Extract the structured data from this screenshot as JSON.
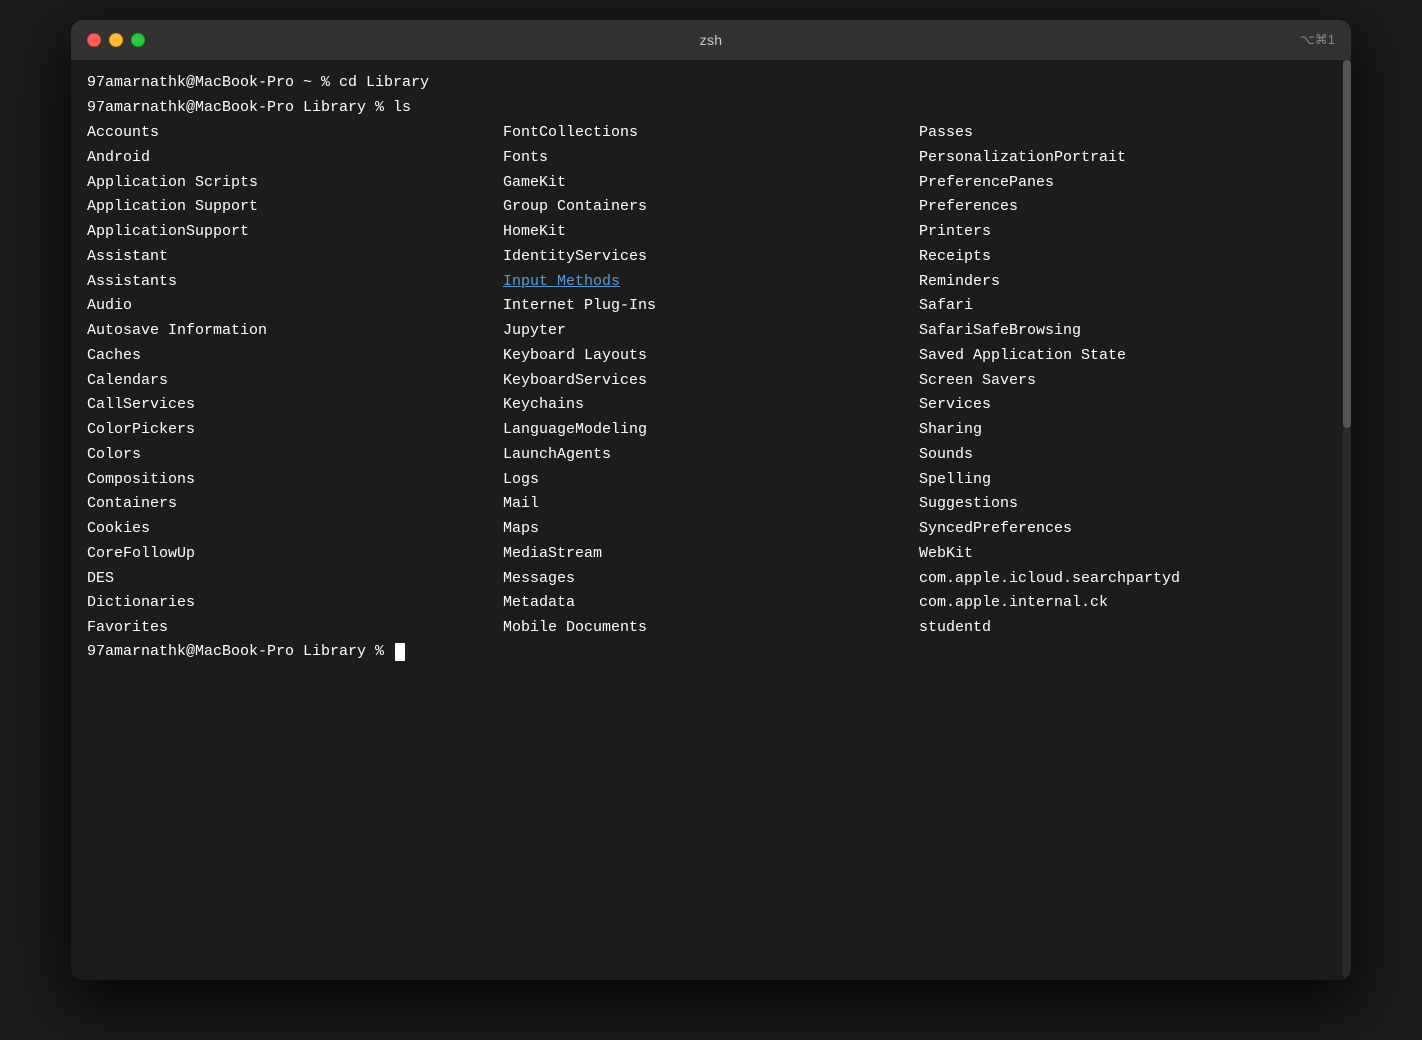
{
  "window": {
    "title": "zsh",
    "keyboard_shortcut": "⌥⌘1"
  },
  "traffic_lights": {
    "close_label": "close",
    "minimize_label": "minimize",
    "maximize_label": "maximize"
  },
  "terminal": {
    "prompt1": "97amarnathk@MacBook-Pro ~ % cd Library",
    "prompt2": "97amarnathk@MacBook-Pro Library % ls",
    "prompt3": "97amarnathk@MacBook-Pro Library % ",
    "columns": [
      [
        {
          "text": "Accounts",
          "link": false
        },
        {
          "text": "Android",
          "link": false
        },
        {
          "text": "Application Scripts",
          "link": false
        },
        {
          "text": "Application Support",
          "link": false
        },
        {
          "text": "ApplicationSupport",
          "link": false
        },
        {
          "text": "Assistant",
          "link": false
        },
        {
          "text": "Assistants",
          "link": false
        },
        {
          "text": "Audio",
          "link": false
        },
        {
          "text": "Autosave Information",
          "link": false
        },
        {
          "text": "Caches",
          "link": false
        },
        {
          "text": "Calendars",
          "link": false
        },
        {
          "text": "CallServices",
          "link": false
        },
        {
          "text": "ColorPickers",
          "link": false
        },
        {
          "text": "Colors",
          "link": false
        },
        {
          "text": "Compositions",
          "link": false
        },
        {
          "text": "Containers",
          "link": false
        },
        {
          "text": "Cookies",
          "link": false
        },
        {
          "text": "CoreFollowUp",
          "link": false
        },
        {
          "text": "DES",
          "link": false
        },
        {
          "text": "Dictionaries",
          "link": false
        },
        {
          "text": "Favorites",
          "link": false
        }
      ],
      [
        {
          "text": "FontCollections",
          "link": false
        },
        {
          "text": "Fonts",
          "link": false
        },
        {
          "text": "GameKit",
          "link": false
        },
        {
          "text": "Group Containers",
          "link": false
        },
        {
          "text": "HomeKit",
          "link": false
        },
        {
          "text": "IdentityServices",
          "link": false
        },
        {
          "text": "Input Methods",
          "link": true
        },
        {
          "text": "Internet Plug-Ins",
          "link": false
        },
        {
          "text": "Jupyter",
          "link": false
        },
        {
          "text": "Keyboard Layouts",
          "link": false
        },
        {
          "text": "KeyboardServices",
          "link": false
        },
        {
          "text": "Keychains",
          "link": false
        },
        {
          "text": "LanguageModeling",
          "link": false
        },
        {
          "text": "LaunchAgents",
          "link": false
        },
        {
          "text": "Logs",
          "link": false
        },
        {
          "text": "Mail",
          "link": false
        },
        {
          "text": "Maps",
          "link": false
        },
        {
          "text": "MediaStream",
          "link": false
        },
        {
          "text": "Messages",
          "link": false
        },
        {
          "text": "Metadata",
          "link": false
        },
        {
          "text": "Mobile Documents",
          "link": false
        }
      ],
      [
        {
          "text": "Passes",
          "link": false
        },
        {
          "text": "PersonalizationPortrait",
          "link": false
        },
        {
          "text": "PreferencePanes",
          "link": false
        },
        {
          "text": "Preferences",
          "link": false
        },
        {
          "text": "Printers",
          "link": false
        },
        {
          "text": "Receipts",
          "link": false
        },
        {
          "text": "Reminders",
          "link": false
        },
        {
          "text": "Safari",
          "link": false
        },
        {
          "text": "SafariSafeBrowsing",
          "link": false
        },
        {
          "text": "Saved Application State",
          "link": false
        },
        {
          "text": "Screen Savers",
          "link": false
        },
        {
          "text": "Services",
          "link": false
        },
        {
          "text": "Sharing",
          "link": false
        },
        {
          "text": "Sounds",
          "link": false
        },
        {
          "text": "Spelling",
          "link": false
        },
        {
          "text": "Suggestions",
          "link": false
        },
        {
          "text": "SyncedPreferences",
          "link": false
        },
        {
          "text": "WebKit",
          "link": false
        },
        {
          "text": "com.apple.icloud.searchpartyd",
          "link": false
        },
        {
          "text": "com.apple.internal.ck",
          "link": false
        },
        {
          "text": "studentd",
          "link": false
        }
      ]
    ]
  }
}
